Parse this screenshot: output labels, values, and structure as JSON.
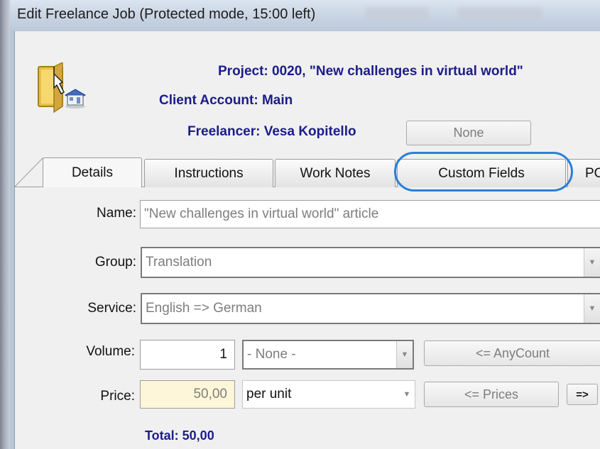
{
  "window": {
    "title": "Edit Freelance Job (Protected mode, 15:00 left)"
  },
  "header": {
    "project": "Project: 0020, \"New challenges in virtual world\"",
    "client_account": "Client Account: Main",
    "freelancer": "Freelancer: Vesa Kopitello",
    "none_button": "None"
  },
  "tabs": [
    {
      "label": "Details",
      "active": true
    },
    {
      "label": "Instructions"
    },
    {
      "label": "Work Notes"
    },
    {
      "label": "Custom Fields",
      "highlighted": true
    },
    {
      "label": "PO"
    }
  ],
  "highlight_color": "#2a7fd6",
  "form": {
    "name_label": "Name:",
    "name_value": "\"New challenges in virtual world\" article",
    "group_label": "Group:",
    "group_value": "Translation",
    "service_label": "Service:",
    "service_value": "English => German",
    "volume_label": "Volume:",
    "volume_value": "1",
    "volume_unit": "- None -",
    "anycount_button": "<= AnyCount",
    "price_label": "Price:",
    "price_value": "50,00",
    "price_unit": "per unit",
    "prices_button": "<= Prices",
    "arrow_button": "=>",
    "total": "Total: 50,00"
  }
}
